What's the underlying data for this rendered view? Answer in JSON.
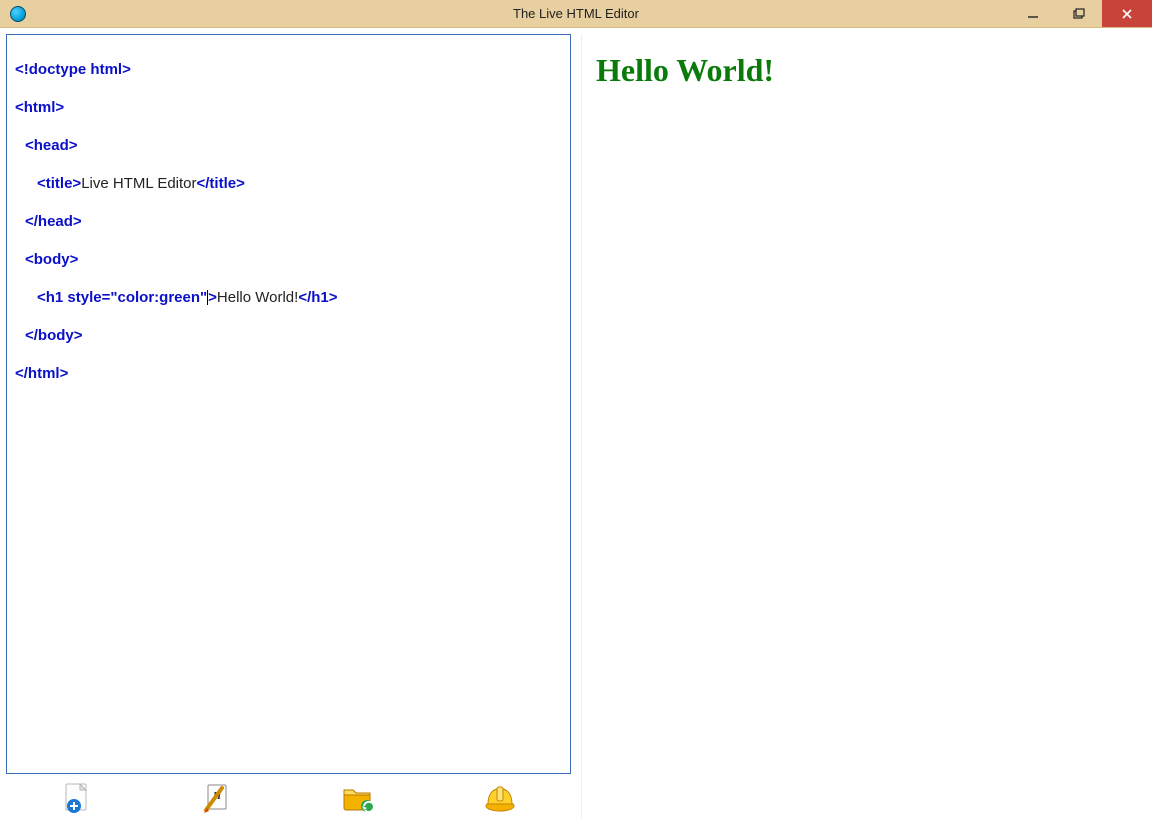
{
  "window": {
    "title": "The Live HTML Editor"
  },
  "code": {
    "l1": {
      "t1": "<!doctype html>"
    },
    "l2": {
      "t1": "<html>"
    },
    "l3": {
      "t1": "<head>"
    },
    "l4": {
      "t1": "<title>",
      "x1": "Live HTML Editor",
      "t2": "</title>"
    },
    "l5": {
      "t1": "</head>"
    },
    "l6": {
      "t1": "<body>"
    },
    "l7": {
      "t1": "<h1 style=\"color:green\"",
      "t1b": ">",
      "x1": "Hello World!",
      "t2": "</h1>"
    },
    "l8": {
      "t1": "</body>"
    },
    "l9": {
      "t1": "</html>"
    }
  },
  "preview": {
    "heading": "Hello World!",
    "heading_color": "#0a7a0a"
  },
  "toolbar": {
    "items": [
      "new-file",
      "edit-html",
      "open-folder",
      "build"
    ]
  }
}
